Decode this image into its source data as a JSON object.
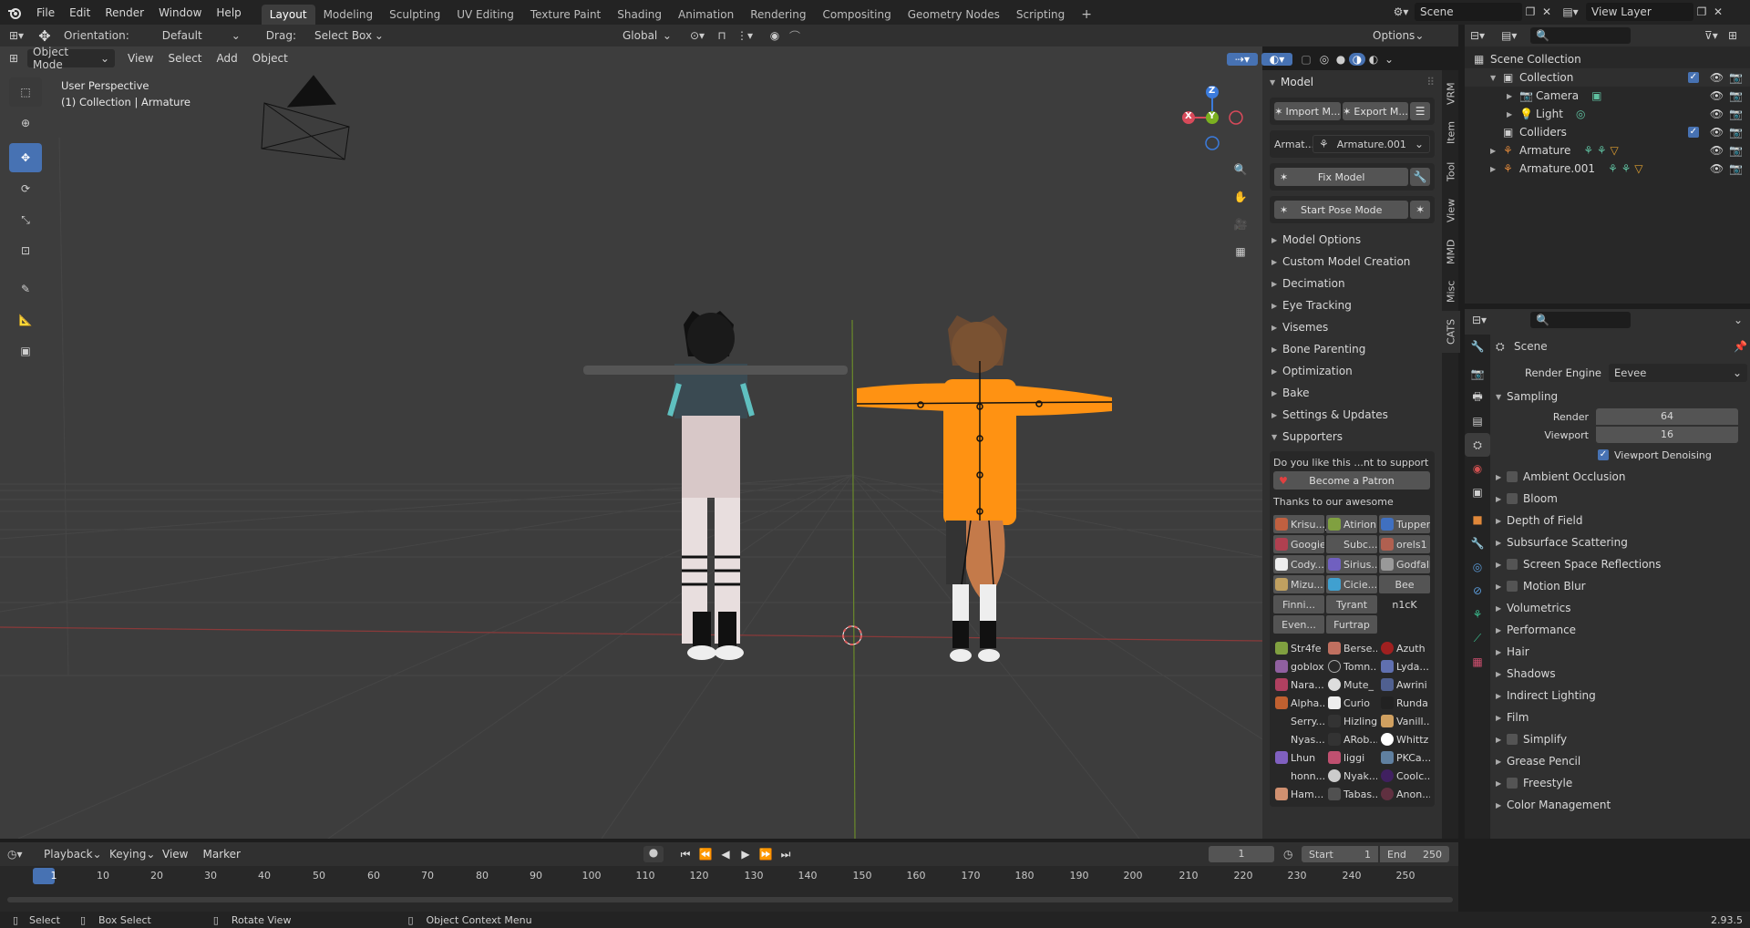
{
  "menu": {
    "items": [
      "File",
      "Edit",
      "Render",
      "Window",
      "Help"
    ]
  },
  "workspaces": [
    "Layout",
    "Modeling",
    "Sculpting",
    "UV Editing",
    "Texture Paint",
    "Shading",
    "Animation",
    "Rendering",
    "Compositing",
    "Geometry Nodes",
    "Scripting"
  ],
  "scene_field": "Scene",
  "view_layer_field": "View Layer",
  "tool_header": {
    "orientation_label": "Orientation:",
    "orientation_value": "Default",
    "drag_label": "Drag:",
    "drag_value": "Select Box",
    "transform_orientation": "Global",
    "options_label": "Options"
  },
  "viewport_header": {
    "mode": "Object Mode",
    "menus": [
      "View",
      "Select",
      "Add",
      "Object"
    ]
  },
  "viewport": {
    "perspective": "User Perspective",
    "collection_info": "(1) Collection | Armature",
    "gizmo": {
      "x": "X",
      "y": "Y",
      "z": "Z"
    }
  },
  "cats_panel": {
    "title": "Model",
    "import_label": "Import M...",
    "export_label": "Export M...",
    "armature_label": "Armat...",
    "armature_value": "Armature.001",
    "fix_model": "Fix Model",
    "start_pose": "Start Pose Mode",
    "sections": [
      "Model Options",
      "Custom Model Creation",
      "Decimation",
      "Eye Tracking",
      "Visemes",
      "Bone Parenting",
      "Optimization",
      "Bake",
      "Settings & Updates"
    ],
    "supporters_title": "Supporters",
    "support_question": "Do you like this ...nt to support us?",
    "patron_button": "Become a Patron",
    "thanks": "Thanks to our awesome supporte...",
    "supporters_buttons": [
      "Krisu...",
      "Atirion",
      "Tupper",
      "Googie",
      "Subc...",
      "orels1",
      "Cody...",
      "Sirius...",
      "Godfall",
      "Mizu...",
      "Cicie...",
      "Bee",
      "Finni...",
      "Tyrant",
      "n1cK",
      "Even...",
      "Furtrap"
    ],
    "supporters_list": [
      "Str4fe",
      "Berse...",
      "Azuth",
      "goblox",
      "Tomn...",
      "Lyda...",
      "Nara...",
      "Mute_",
      "Awrini",
      "Alpha...",
      "Curio",
      "Runda",
      "Serry...",
      "Hizling",
      "Vanill...",
      "Nyas...",
      "ARob...",
      "Whittz",
      "Lhun",
      "liggi",
      "PKCa...",
      "honn...",
      "Nyak...",
      "Coolc...",
      "Ham...",
      "Tabas...",
      "Anon..."
    ]
  },
  "side_tabs": [
    "VRM",
    "Item",
    "Tool",
    "View",
    "MMD",
    "Misc",
    "CATS"
  ],
  "outliner": {
    "scene_collection": "Scene Collection",
    "items": [
      {
        "name": "Collection"
      },
      {
        "name": "Camera"
      },
      {
        "name": "Light"
      },
      {
        "name": "Colliders"
      },
      {
        "name": "Armature"
      },
      {
        "name": "Armature.001"
      }
    ]
  },
  "properties": {
    "context": "Scene",
    "render_engine_label": "Render Engine",
    "render_engine_value": "Eevee",
    "sampling_title": "Sampling",
    "render_label": "Render",
    "render_value": "64",
    "viewport_label": "Viewport",
    "viewport_value": "16",
    "viewport_denoising": "Viewport Denoising",
    "sections": [
      "Ambient Occlusion",
      "Bloom",
      "Depth of Field",
      "Subsurface Scattering",
      "Screen Space Reflections",
      "Motion Blur",
      "Volumetrics",
      "Performance",
      "Hair",
      "Shadows",
      "Indirect Lighting",
      "Film",
      "Simplify",
      "Grease Pencil",
      "Freestyle",
      "Color Management"
    ]
  },
  "timeline": {
    "menus": [
      "Playback",
      "Keying",
      "View",
      "Marker"
    ],
    "current_frame": "1",
    "start_label": "Start",
    "start_value": "1",
    "end_label": "End",
    "end_value": "250",
    "ruler": [
      "1",
      "10",
      "20",
      "30",
      "40",
      "50",
      "60",
      "70",
      "80",
      "90",
      "100",
      "110",
      "120",
      "130",
      "140",
      "150",
      "160",
      "170",
      "180",
      "190",
      "200",
      "210",
      "220",
      "230",
      "240",
      "250"
    ]
  },
  "statusbar": {
    "select": "Select",
    "box_select": "Box Select",
    "rotate_view": "Rotate View",
    "context_menu": "Object Context Menu",
    "version": "2.93.5"
  }
}
